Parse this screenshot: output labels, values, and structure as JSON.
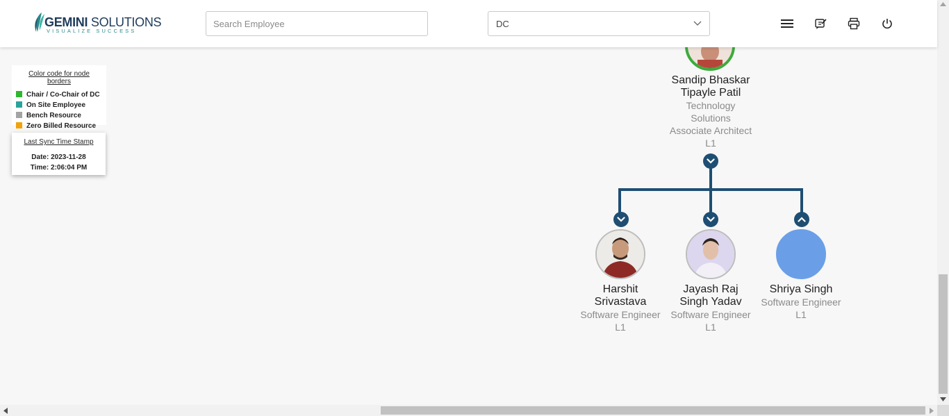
{
  "header": {
    "logo_primary": "GEMINI",
    "logo_secondary": "SOLUTIONS",
    "logo_tagline": "VISUALIZE SUCCESS",
    "search_placeholder": "Search Employee",
    "dc_select_value": "DC",
    "icons": [
      "menu-icon",
      "feedback-edit-icon",
      "print-icon",
      "power-icon"
    ]
  },
  "legend": {
    "title": "Color code for node borders",
    "items": [
      {
        "label": "Chair / Co-Chair of DC",
        "color": "#2db82d"
      },
      {
        "label": "On Site Employee",
        "color": "#2aa39b"
      },
      {
        "label": "Bench Resource",
        "color": "#a3a3a3"
      },
      {
        "label": "Zero Billed Resource",
        "color": "#f0a30a"
      }
    ]
  },
  "sync": {
    "title": "Last Sync Time Stamp",
    "date": "Date: 2023-11-28",
    "time": "Time: 2:06:04 PM"
  },
  "tree": {
    "root": {
      "name_line1": "Sandip Bhaskar",
      "name_line2": "Tipayle Patil",
      "dept_line1": "Technology",
      "dept_line2": "Solutions",
      "role": "Associate Architect",
      "level": "L1",
      "border_color": "#3dab3d"
    },
    "children": [
      {
        "name_line1": "Harshit",
        "name_line2": "Srivastava",
        "role": "Software Engineer",
        "level": "L1",
        "toggle": "expand"
      },
      {
        "name_line1": "Jayash Raj",
        "name_line2": "Singh Yadav",
        "role": "Software Engineer",
        "level": "L1",
        "toggle": "expand"
      },
      {
        "name_line1": "Shriya Singh",
        "role": "Software Engineer",
        "level": "L1",
        "toggle": "collapse"
      }
    ]
  },
  "colors": {
    "connector": "#1f4e73",
    "placeholder_avatar": "#6a9fe8"
  }
}
